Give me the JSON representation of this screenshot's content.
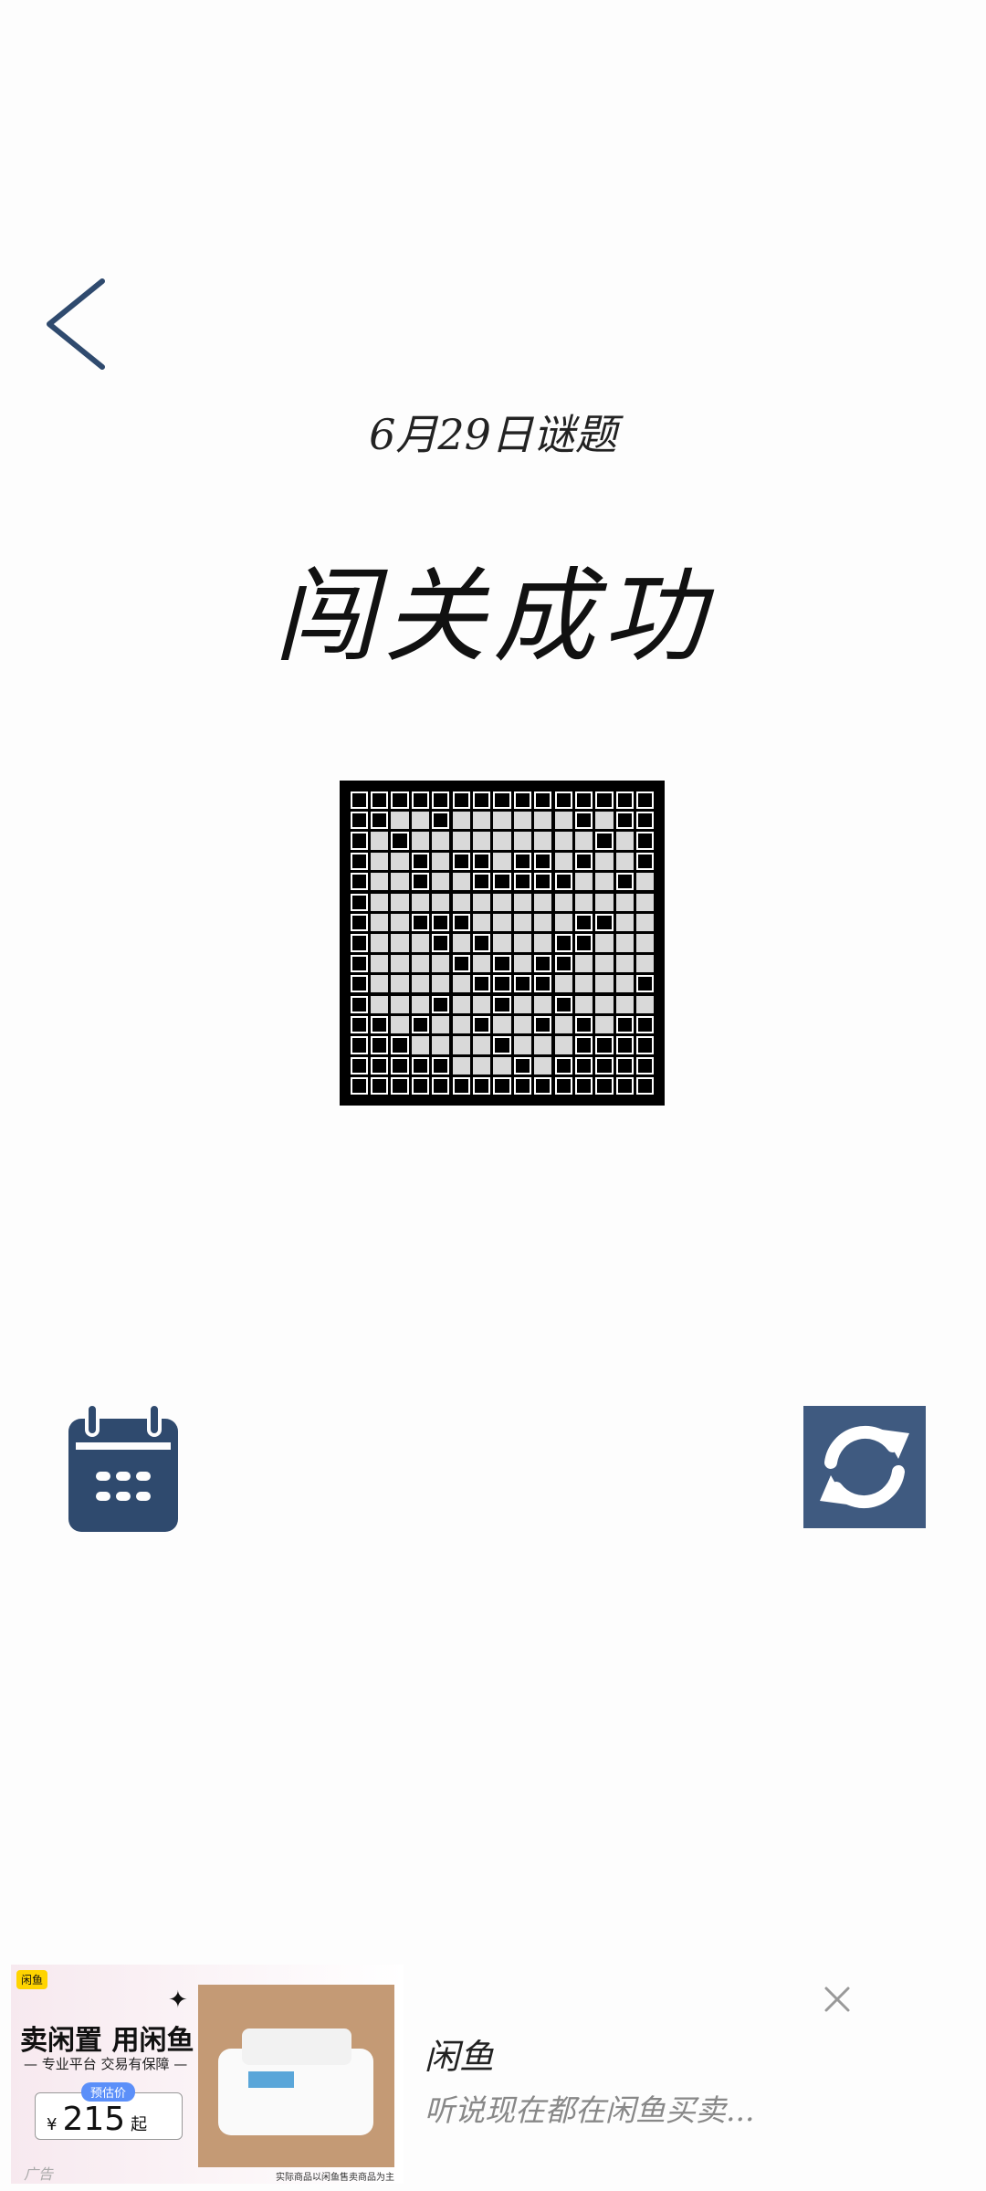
{
  "header": {
    "date_title": "6月29日谜题",
    "result_title": "闯关成功"
  },
  "icons": {
    "back": "chevron-left-icon",
    "calendar": "calendar-icon",
    "refresh": "refresh-icon",
    "close": "close-icon"
  },
  "colors": {
    "icon_navy": "#2f4a6e",
    "refresh_bg": "#3f5a80",
    "puzzle_border": "#000000",
    "cell_filled": "#000000",
    "cell_empty": "#d9d9d9"
  },
  "puzzle": {
    "size": 15,
    "rows": [
      "111111111111111",
      "110010000001011",
      "101000000000101",
      "100101101101001",
      "100100111110010",
      "100000000000000",
      "100111000001100",
      "100010100011000",
      "100001010110000",
      "100000111100001",
      "100010010010000",
      "110100100101011",
      "111000010001111",
      "111110001011111",
      "111111111111111"
    ]
  },
  "ad": {
    "tag": "闲鱼",
    "slogan": "卖闲置 用闲鱼",
    "sub": "— 专业平台 交易有保障 —",
    "price_label": "预估价",
    "currency": "¥",
    "price": "215",
    "price_unit": "起",
    "disclaimer": "实际商品以闲鱼售卖商品为主",
    "ad_label": "广告",
    "app_name": "闲鱼",
    "description": "听说现在都在闲鱼买卖..."
  }
}
